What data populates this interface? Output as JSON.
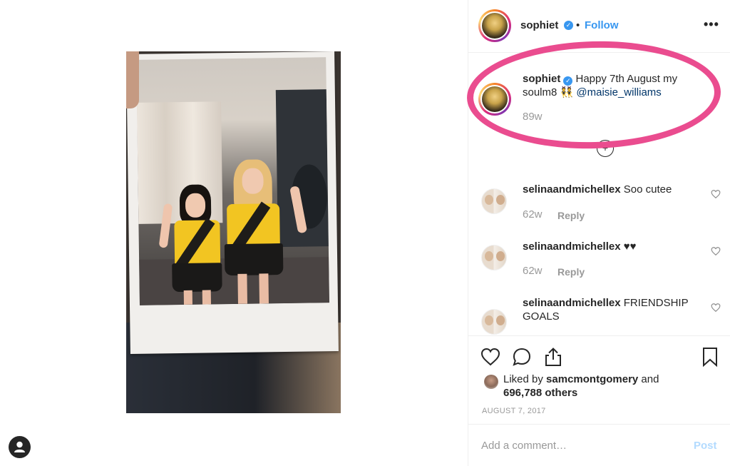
{
  "header": {
    "username": "sophiet",
    "separator": "•",
    "follow_label": "Follow",
    "more_icon": "more-options-icon",
    "more_glyph": "•••"
  },
  "caption": {
    "username": "sophiet",
    "text_before": " Happy 7th August my soulm8 👯 ",
    "mention": "@maisie_williams",
    "time": "89w"
  },
  "load_more_glyph": "+",
  "comments": [
    {
      "username": "selinaandmichellex",
      "text": " Soo cutee",
      "time": "62w",
      "reply": "Reply"
    },
    {
      "username": "selinaandmichellex",
      "text": " ♥♥",
      "time": "62w",
      "reply": "Reply"
    },
    {
      "username": "selinaandmichellex",
      "text": " FRIENDSHIP GOALS",
      "time": "",
      "reply": ""
    }
  ],
  "actions": {
    "icons": [
      "heart-icon",
      "comment-icon",
      "share-icon",
      "bookmark-icon"
    ]
  },
  "likes": {
    "prefix": "Liked by ",
    "user": "samcmontgomery",
    "middle": " and",
    "count": "696,788 others"
  },
  "date": "AUGUST 7, 2017",
  "add_comment": {
    "placeholder": "Add a comment…",
    "post_label": "Post"
  },
  "colors": {
    "accent_blue": "#3897f0",
    "highlight_pink": "#ea4c8f",
    "muted": "#999999",
    "post_disabled": "#b3dbff"
  }
}
